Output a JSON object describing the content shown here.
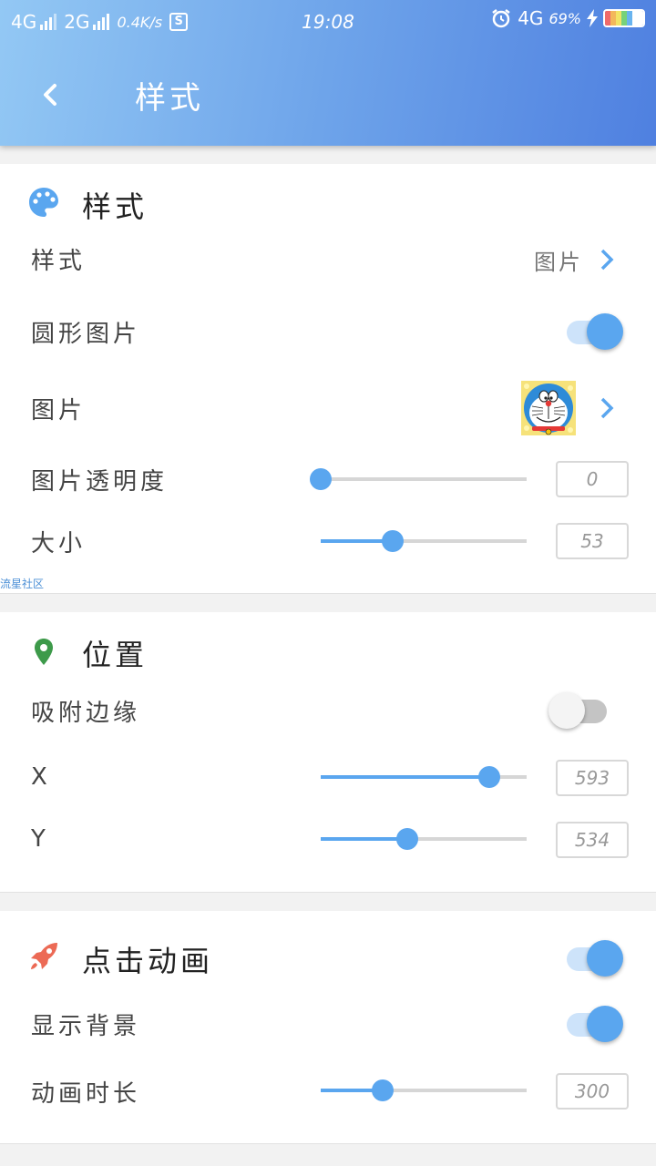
{
  "status_bar": {
    "net1": "4G",
    "net2": "2G",
    "speed": "0.4K/s",
    "s_badge": "S",
    "time": "19:08",
    "net3": "4G",
    "battery": "69%"
  },
  "header": {
    "title": "样式"
  },
  "style_section": {
    "title": "样式",
    "icon": "palette-icon",
    "style_row": {
      "label": "样式",
      "value": "图片"
    },
    "circle_row": {
      "label": "圆形图片",
      "enabled": true
    },
    "image_row": {
      "label": "图片",
      "image": "doraemon-image"
    },
    "opacity_row": {
      "label": "图片透明度",
      "value": "0",
      "fraction": 0.0
    },
    "size_row": {
      "label": "大小",
      "value": "53",
      "fraction": 0.35
    }
  },
  "watermark": "流星社区",
  "position_section": {
    "title": "位置",
    "icon": "map-pin-icon",
    "snap_row": {
      "label": "吸附边缘",
      "enabled": false
    },
    "x_row": {
      "label": "X",
      "value": "593",
      "fraction": 0.82
    },
    "y_row": {
      "label": "Y",
      "value": "534",
      "fraction": 0.42
    }
  },
  "animation_section": {
    "title": "点击动画",
    "icon": "rocket-icon",
    "enabled": true,
    "bg_row": {
      "label": "显示背景",
      "enabled": true
    },
    "duration_row": {
      "label": "动画时长",
      "value": "300",
      "fraction": 0.3
    }
  },
  "colors": {
    "accent": "#5aa6ef",
    "header_start": "#93c8f4",
    "header_end": "#4f80e0"
  }
}
